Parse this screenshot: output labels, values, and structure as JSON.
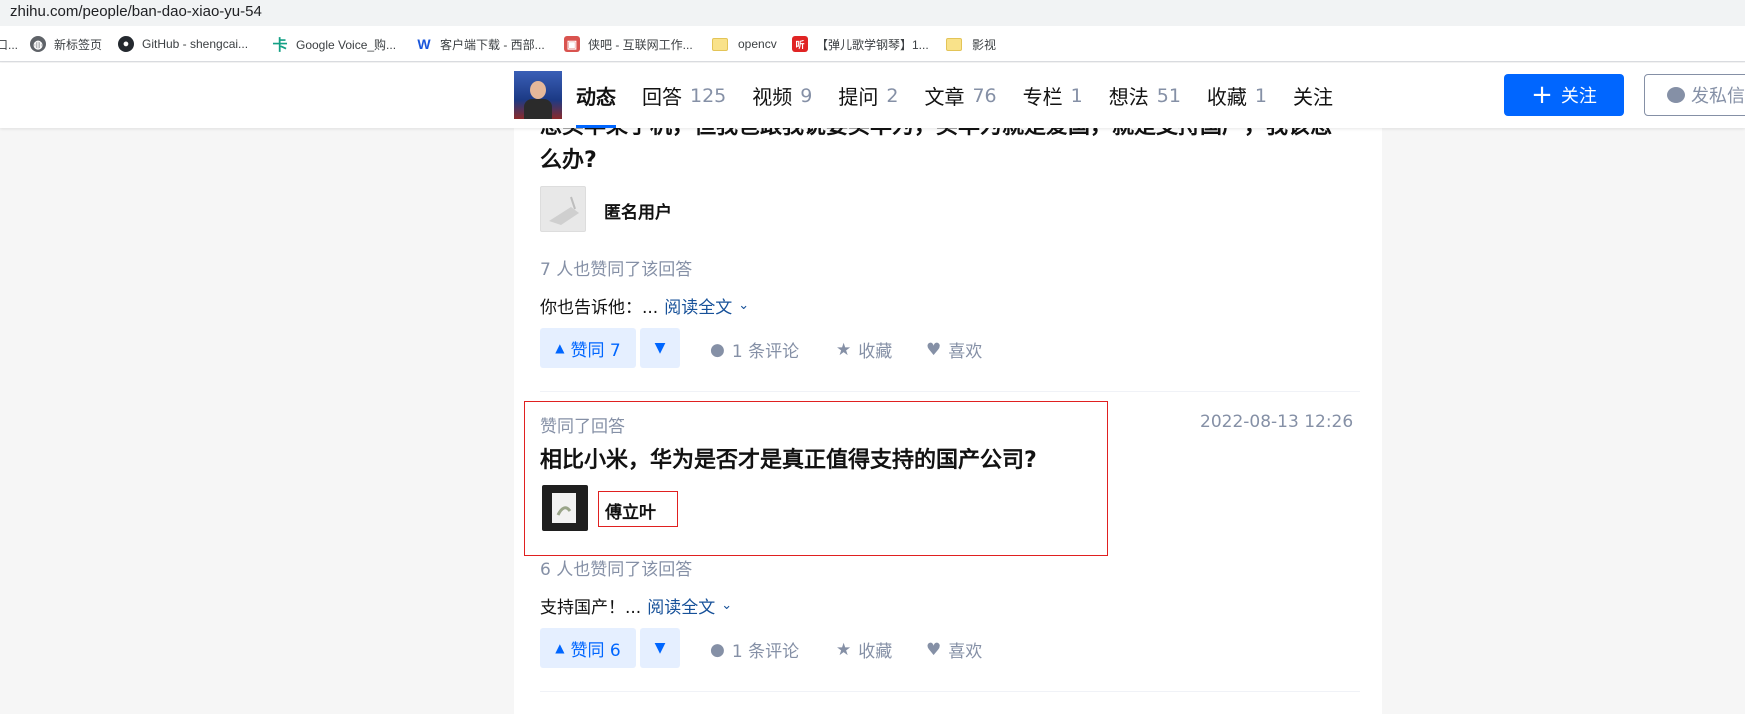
{
  "browser": {
    "url": "zhihu.com/people/ban-dao-xiao-yu-54",
    "bookmarks": [
      {
        "label": "新标签页",
        "icon": "globe-icon"
      },
      {
        "label": "GitHub - shengcai...",
        "icon": "github-icon"
      },
      {
        "label": "Google Voice_购...",
        "icon": "k-icon"
      },
      {
        "label": "客户端下载 - 西部...",
        "icon": "w-icon"
      },
      {
        "label": "侠吧 - 互联网工作...",
        "icon": "app-icon"
      },
      {
        "label": "opencv",
        "icon": "folder-icon"
      },
      {
        "label": "【弹儿歌学钢琴】1...",
        "icon": "video-icon"
      },
      {
        "label": "影视",
        "icon": "folder-icon"
      }
    ],
    "partial_bookmark": "口..."
  },
  "header": {
    "tabs": [
      {
        "label": "动态",
        "count": ""
      },
      {
        "label": "回答",
        "count": "125"
      },
      {
        "label": "视频",
        "count": "9"
      },
      {
        "label": "提问",
        "count": "2"
      },
      {
        "label": "文章",
        "count": "76"
      },
      {
        "label": "专栏",
        "count": "1"
      },
      {
        "label": "想法",
        "count": "51"
      },
      {
        "label": "收藏",
        "count": "1"
      },
      {
        "label": "关注",
        "count": ""
      }
    ],
    "follow_label": "关注",
    "message_label": "发私信"
  },
  "feed": {
    "item1": {
      "title_line1": "想买苹果手机，但我爸跟我说要买华为，买华为就是爱国，就是支持国产，我该怎",
      "title_line2": "么办?",
      "author": "匿名用户",
      "likes_meta": "7 人也赞同了该回答",
      "excerpt": "你也告诉他：...",
      "read_more": "阅读全文",
      "vote_label": "赞同 7",
      "comments": "1 条评论",
      "collect": "收藏",
      "like": "喜欢"
    },
    "item2": {
      "action": "赞同了回答",
      "time": "2022-08-13 12:26",
      "title": "相比小米，华为是否才是真正值得支持的国产公司?",
      "author": "傅立叶",
      "likes_meta": "6 人也赞同了该回答",
      "excerpt": "支持国产！...",
      "read_more": "阅读全文",
      "vote_label": "赞同 6",
      "comments": "1 条评论",
      "collect": "收藏",
      "like": "喜欢"
    }
  },
  "colors": {
    "brand": "#0066ff",
    "meta": "#8590a6",
    "highlight": "#e02020"
  }
}
